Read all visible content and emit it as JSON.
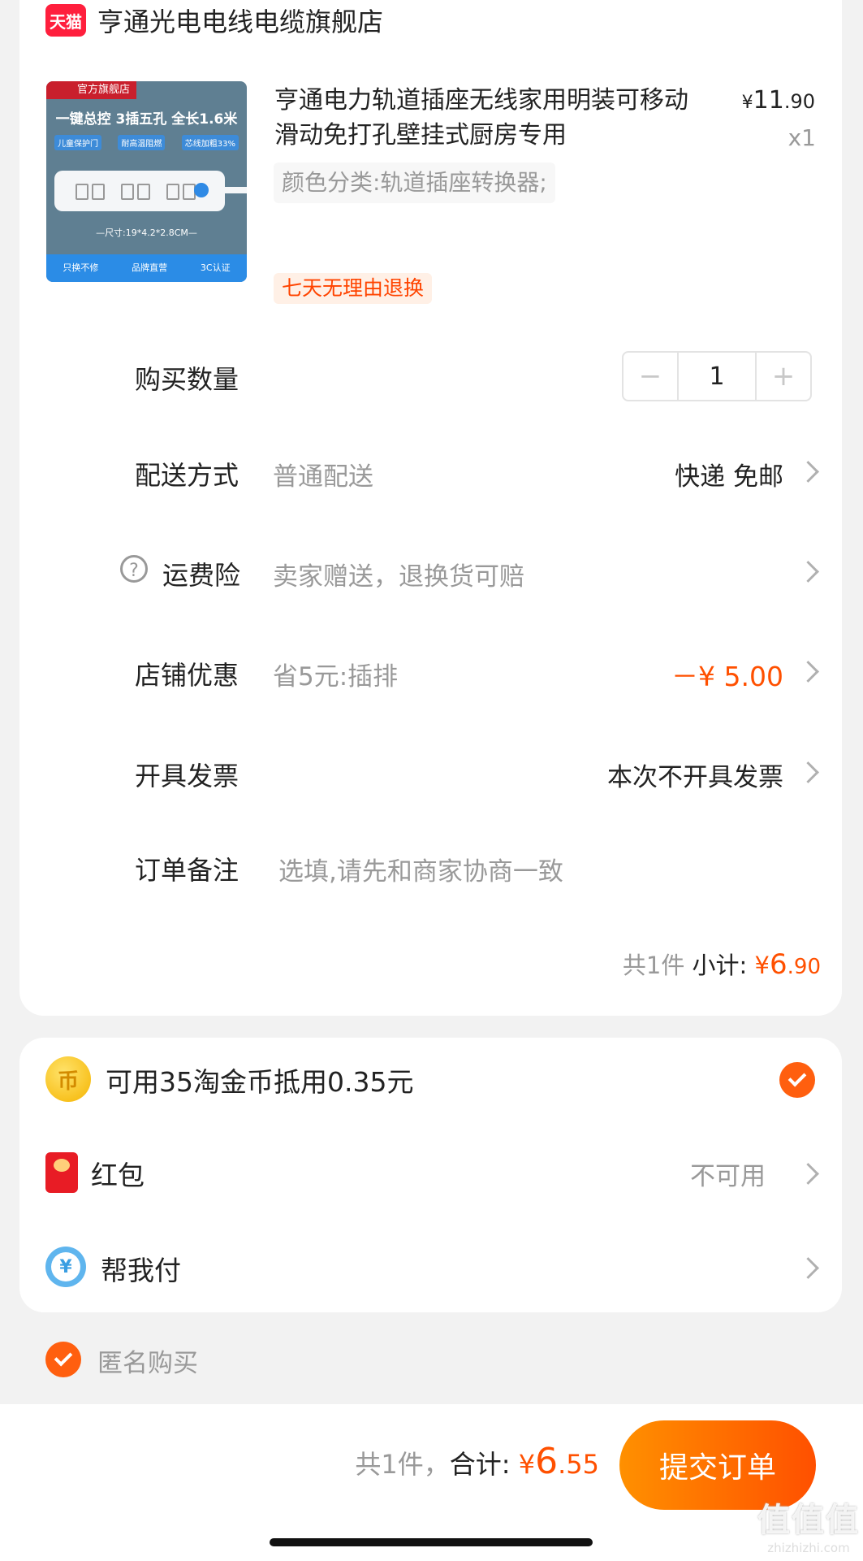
{
  "store": {
    "badge": "天猫",
    "name": "亨通光电电线电缆旗舰店"
  },
  "product": {
    "image": {
      "tag": "官方旗舰店",
      "headline": "一键总控 3插五孔 全长1.6米",
      "features": [
        "儿童保护门",
        "耐高温阻燃",
        "芯线加粗33%"
      ],
      "size": "—尺寸:19*4.2*2.8CM—",
      "bottom": [
        "只换不修",
        "品牌直营",
        "3C认证"
      ]
    },
    "title": "亨通电力轨道插座无线家用明装可移动滑动免打孔壁挂式厨房专用",
    "price_symbol": "¥",
    "price_int": "11",
    "price_dec": ".90",
    "qty_label": "x1",
    "sku": "颜色分类:轨道插座转换器;",
    "return_tag": "七天无理由退换"
  },
  "quantity": {
    "label": "购买数量",
    "minus": "−",
    "value": "1",
    "plus": "+"
  },
  "delivery": {
    "label": "配送方式",
    "value": "普通配送",
    "right": "快递 免邮"
  },
  "insurance": {
    "label": "运费险",
    "value": "卖家赠送，退换货可赔"
  },
  "store_discount": {
    "label": "店铺优惠",
    "value": "省5元:插排",
    "right": "－¥ 5.00"
  },
  "invoice": {
    "label": "开具发票",
    "right": "本次不开具发票"
  },
  "note": {
    "label": "订单备注",
    "placeholder": "选填,请先和商家协商一致"
  },
  "subtotal": {
    "count": "共1件",
    "label": "小计:",
    "symbol": "¥",
    "int": "6",
    "dec": ".90"
  },
  "coins": {
    "icon": "币",
    "text": "可用35淘金币抵用0.35元"
  },
  "red_packet": {
    "label": "红包",
    "status": "不可用"
  },
  "help_pay": {
    "icon": "¥",
    "label": "帮我付"
  },
  "anonymous": {
    "label": "匿名购买"
  },
  "footer": {
    "count": "共1件，",
    "label": "合计:",
    "symbol": "¥",
    "int": "6",
    "dec": ".55",
    "submit": "提交订单"
  },
  "watermark": {
    "main": "值值值",
    "sub": "zhizhizhi.com"
  },
  "colors": {
    "accent": "#ff5000",
    "tmall_red": "#ff1f3d",
    "muted": "#999999"
  }
}
